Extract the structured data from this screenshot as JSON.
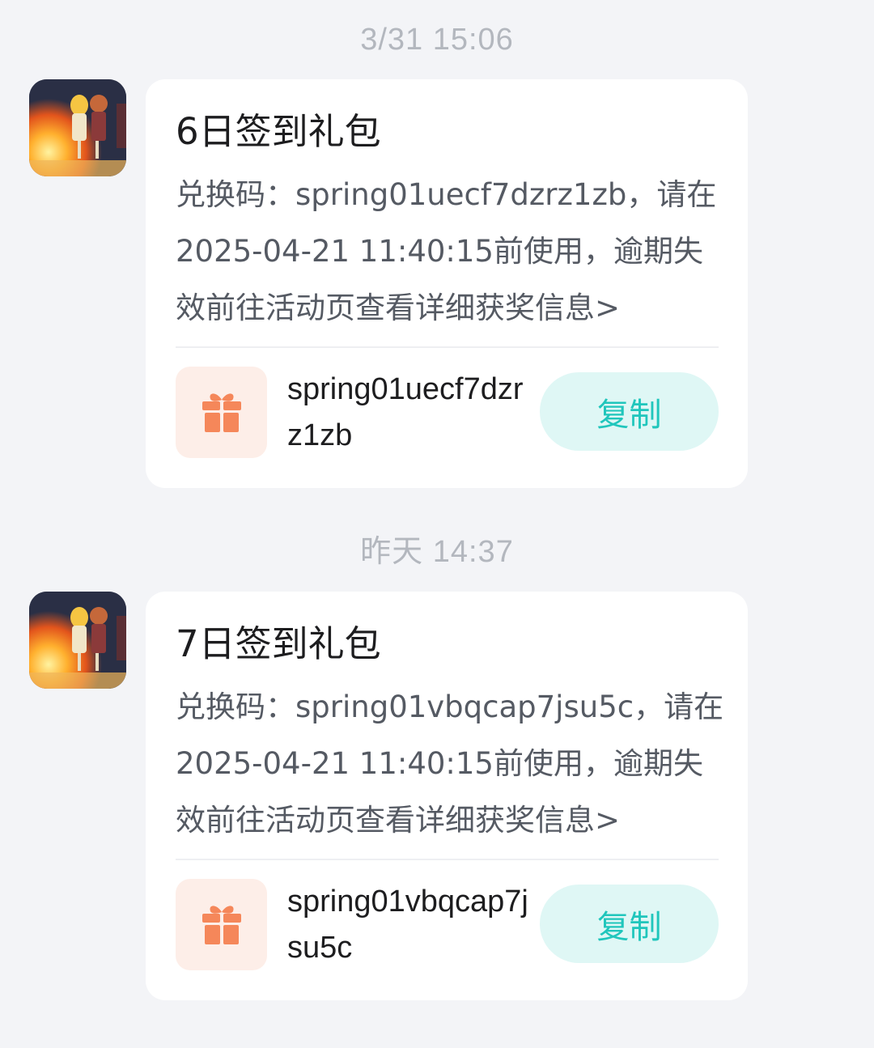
{
  "messages": [
    {
      "timestamp": "3/31  15:06",
      "title": "6日签到礼包",
      "body": "兑换码：spring01uecf7dzrz1zb，请在2025-04-21 11:40:15前使用，逾期失效前往活动页查看详细获奖信息>",
      "code": "spring01uecf7dzrz1zb",
      "copy_label": "复制",
      "avatar_icon": "game-avatar-campfire-icon",
      "gift_icon": "gift-icon"
    },
    {
      "timestamp": "昨天  14:37",
      "title": "7日签到礼包",
      "body": "兑换码：spring01vbqcap7jsu5c，请在2025-04-21 11:40:15前使用，逾期失效前往活动页查看详细获奖信息>",
      "code": "spring01vbqcap7jsu5c",
      "copy_label": "复制",
      "avatar_icon": "game-avatar-campfire-icon",
      "gift_icon": "gift-icon"
    }
  ],
  "colors": {
    "background": "#f3f4f7",
    "card": "#ffffff",
    "accent_teal": "#20c6bc",
    "copy_button_bg": "#dff7f5",
    "gift_orange": "#f5875a",
    "gift_bg": "#fdeee8",
    "timestamp": "#b3b7be"
  }
}
